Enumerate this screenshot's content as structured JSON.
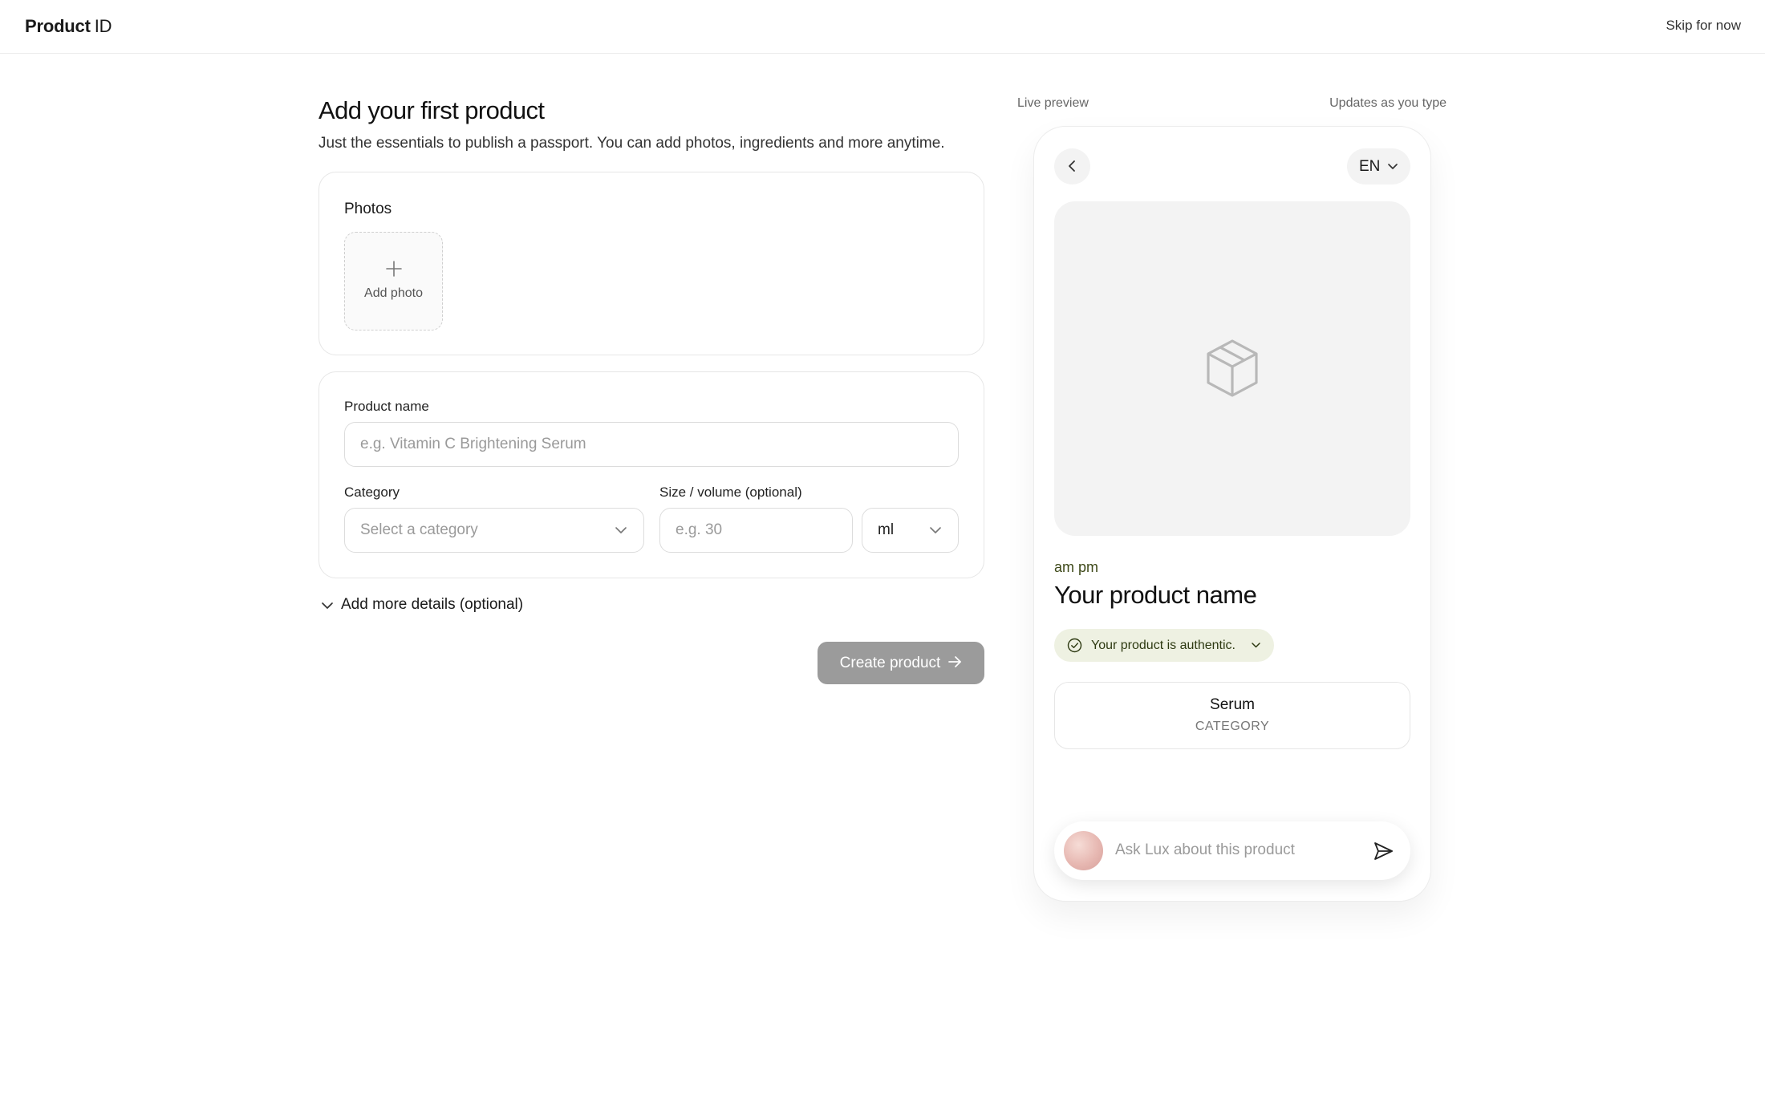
{
  "header": {
    "brand_bold": "Product",
    "brand_light": "ID",
    "skip_label": "Skip for now"
  },
  "form": {
    "title": "Add your first product",
    "subtitle": "Just the essentials to publish a passport. You can add photos, ingredients and more anytime.",
    "photos_title": "Photos",
    "add_photo_label": "Add photo",
    "product_name_label": "Product name",
    "product_name_placeholder": "e.g. Vitamin C Brightening Serum",
    "category_label": "Category",
    "category_placeholder": "Select a category",
    "size_label": "Size / volume (optional)",
    "size_placeholder": "e.g. 30",
    "unit_value": "ml",
    "more_details_label": "Add more details (optional)",
    "create_label": "Create product"
  },
  "preview": {
    "label": "Live preview",
    "updates_label": "Updates as you type",
    "language": "EN",
    "brand_name": "am pm",
    "product_name": "Your product name",
    "authentic_label": "Your product is authentic.",
    "category_value": "Serum",
    "category_caption": "CATEGORY",
    "ask_placeholder": "Ask Lux about this product"
  },
  "colors": {
    "accent_olive": "#3f4a1a",
    "auth_pill_bg": "#eef1e2",
    "button_disabled": "#9b9b9b"
  },
  "icons": [
    "plus-icon",
    "chevron-down-icon",
    "arrow-right-icon",
    "chevron-left-icon",
    "box-icon",
    "check-circle-icon",
    "send-icon"
  ]
}
